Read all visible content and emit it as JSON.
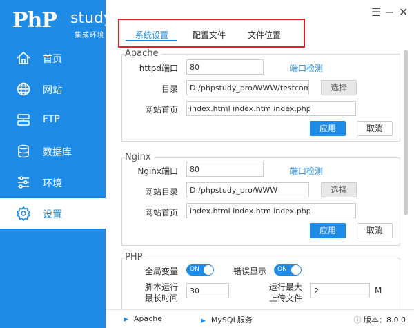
{
  "logo": {
    "php": "PhP",
    "study": "study",
    "subtitle": "集成环境"
  },
  "sidebar": {
    "items": [
      {
        "label": "首页",
        "icon": "home-icon"
      },
      {
        "label": "网站",
        "icon": "globe-icon"
      },
      {
        "label": "FTP",
        "icon": "ftp-icon"
      },
      {
        "label": "数据库",
        "icon": "database-icon"
      },
      {
        "label": "环境",
        "icon": "sliders-icon"
      },
      {
        "label": "设置",
        "icon": "gear-icon",
        "active": true
      }
    ]
  },
  "window": {
    "menu": "☰",
    "minimize": "−",
    "close": "✕"
  },
  "tabs": [
    {
      "label": "系统设置",
      "active": true
    },
    {
      "label": "配置文件"
    },
    {
      "label": "文件位置"
    }
  ],
  "apache": {
    "title": "Apache",
    "port_label": "httpd端口",
    "port_value": "80",
    "port_check": "端口检测",
    "dir_label": "目录",
    "dir_value": "D:/phpstudy_pro/WWW/testcom",
    "select": "选择",
    "index_label": "网站首页",
    "index_value": "index.html index.htm index.php",
    "apply": "应用",
    "cancel": "取消"
  },
  "nginx": {
    "title": "Nginx",
    "port_label": "Nginx端口",
    "port_value": "80",
    "port_check": "端口检测",
    "dir_label": "网站目录",
    "dir_value": "D:/phpstudy_pro/WWW",
    "select": "选择",
    "index_label": "网站首页",
    "index_value": "index.html index.htm index.php",
    "apply": "应用",
    "cancel": "取消"
  },
  "php": {
    "title": "PHP",
    "global_vars": "全局变量",
    "global_vars_state": "ON",
    "error_display": "错误显示",
    "error_display_state": "ON",
    "max_exec_label_1": "脚本运行",
    "max_exec_label_2": "最长时间",
    "max_exec_value": "30",
    "upload_label_1": "运行最大",
    "upload_label_2": "上传文件",
    "upload_value": "2",
    "upload_unit": "M"
  },
  "bottom": {
    "apache": "Apache",
    "mysql": "MySQL服务",
    "version_label": "版本：",
    "version_value": "8.0.0"
  },
  "colors": {
    "accent": "#1e8ce6",
    "highlight_frame": "#e0202a"
  }
}
